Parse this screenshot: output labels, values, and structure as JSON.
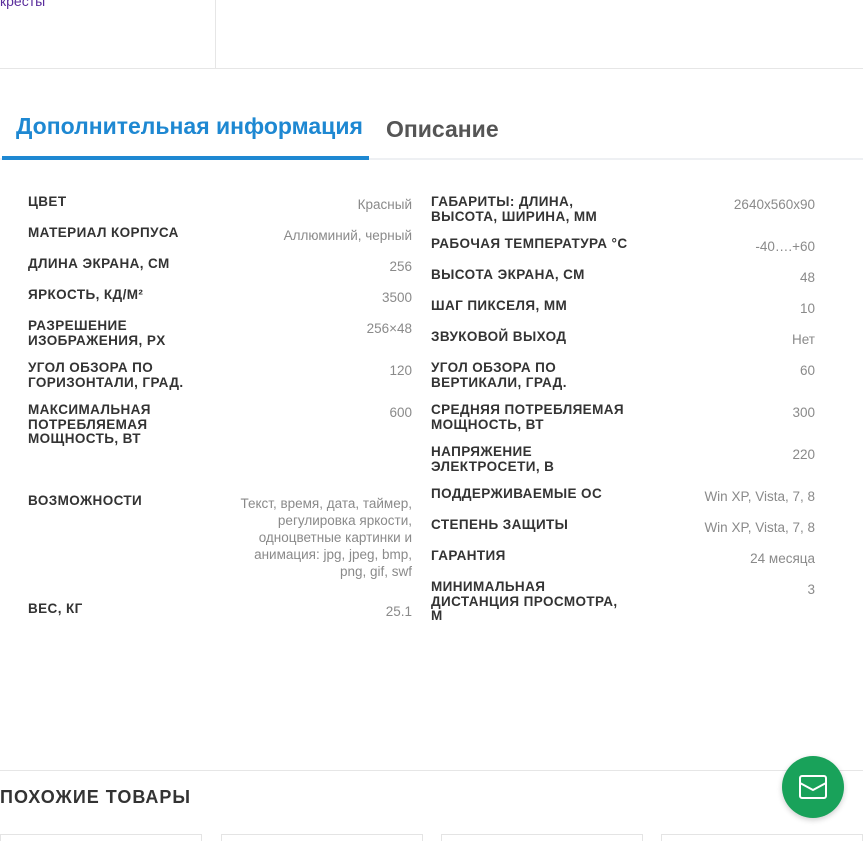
{
  "top": {
    "link_text": "кресты"
  },
  "tabs": [
    {
      "label": "Дополнительная информация"
    },
    {
      "label": "Описание"
    }
  ],
  "specs_left": [
    {
      "label": "Цвет",
      "value": "Красный"
    },
    {
      "label": "Материал корпуса",
      "value": "Аллюминий, черный"
    },
    {
      "label": "Длина экрана, см",
      "value": "256"
    },
    {
      "label": "Яркость, кд/м²",
      "value": "3500"
    },
    {
      "label": "Разрешение изображения, px",
      "value": "256×48"
    },
    {
      "label": "Угол обзора по горизонтали, град.",
      "value": "120"
    },
    {
      "label": "Максимальная потребляемая мощность, Вт",
      "value": "600"
    },
    {
      "label": "Возможности",
      "value": "Текст, время, дата, таймер, регулировка яркости, одноцветные картинки и анимация: jpg, jpeg, bmp, png, gif, swf"
    },
    {
      "label": "Вес, кг",
      "value": "25.1"
    }
  ],
  "specs_right": [
    {
      "label": "Габариты: Длина, Высота, Ширина, мм",
      "value": "2640x560x90"
    },
    {
      "label": "Рабочая температура °C",
      "value": "-40….+60"
    },
    {
      "label": "Высота экрана, см",
      "value": "48"
    },
    {
      "label": "Шаг пикселя, мм",
      "value": "10"
    },
    {
      "label": "Звуковой выход",
      "value": "Нет"
    },
    {
      "label": "Угол обзора по вертикали, град.",
      "value": "60"
    },
    {
      "label": "Средняя потребляемая мощность, Вт",
      "value": "300"
    },
    {
      "label": "Напряжение электросети, В",
      "value": "220"
    },
    {
      "label": "Поддерживаемые ОС",
      "value": "Win XP, Vista, 7, 8"
    },
    {
      "label": "Степень защиты",
      "value": "Win XP, Vista, 7, 8"
    },
    {
      "label": "Гарантия",
      "value": "24 месяца"
    },
    {
      "label": "Минимальная дистанция просмотра, м",
      "value": "3"
    }
  ],
  "similar": {
    "title": "ПОХОЖИЕ ТОВАРЫ"
  },
  "icons": {
    "mail": "mail-icon"
  },
  "colors": {
    "accent": "#1e88d2",
    "mail_button": "#19a25a"
  }
}
